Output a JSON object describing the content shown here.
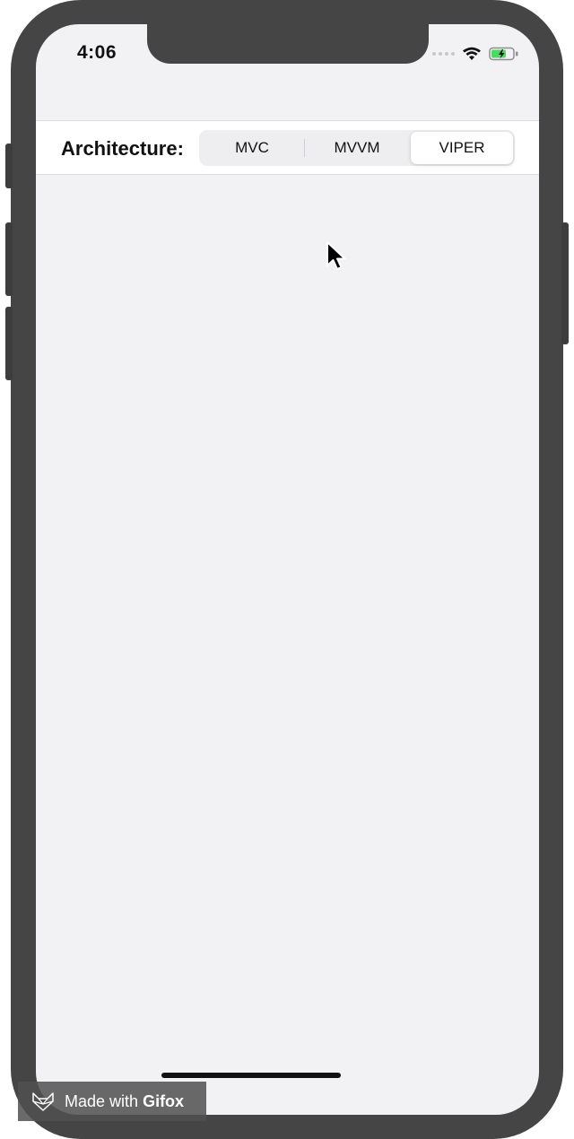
{
  "status_bar": {
    "time": "4:06",
    "battery_color": "#4cd964"
  },
  "toolbar": {
    "label": "Architecture:",
    "segments": [
      "MVC",
      "MVVM",
      "VIPER"
    ],
    "selected_segment": "VIPER"
  },
  "watermark": {
    "prefix": "Made with",
    "brand": "Gifox"
  },
  "colors": {
    "screen_background": "#f2f2f5",
    "device_frame": "#454545"
  }
}
